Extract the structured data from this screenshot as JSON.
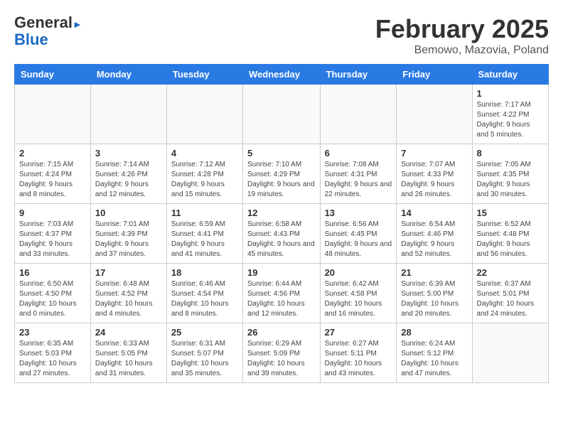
{
  "header": {
    "logo_line1": "General",
    "logo_line2": "Blue",
    "month_title": "February 2025",
    "location": "Bemowo, Mazovia, Poland"
  },
  "days_of_week": [
    "Sunday",
    "Monday",
    "Tuesday",
    "Wednesday",
    "Thursday",
    "Friday",
    "Saturday"
  ],
  "weeks": [
    [
      {
        "day": "",
        "info": ""
      },
      {
        "day": "",
        "info": ""
      },
      {
        "day": "",
        "info": ""
      },
      {
        "day": "",
        "info": ""
      },
      {
        "day": "",
        "info": ""
      },
      {
        "day": "",
        "info": ""
      },
      {
        "day": "1",
        "info": "Sunrise: 7:17 AM\nSunset: 4:22 PM\nDaylight: 9 hours and 5 minutes."
      }
    ],
    [
      {
        "day": "2",
        "info": "Sunrise: 7:15 AM\nSunset: 4:24 PM\nDaylight: 9 hours and 8 minutes."
      },
      {
        "day": "3",
        "info": "Sunrise: 7:14 AM\nSunset: 4:26 PM\nDaylight: 9 hours and 12 minutes."
      },
      {
        "day": "4",
        "info": "Sunrise: 7:12 AM\nSunset: 4:28 PM\nDaylight: 9 hours and 15 minutes."
      },
      {
        "day": "5",
        "info": "Sunrise: 7:10 AM\nSunset: 4:29 PM\nDaylight: 9 hours and 19 minutes."
      },
      {
        "day": "6",
        "info": "Sunrise: 7:08 AM\nSunset: 4:31 PM\nDaylight: 9 hours and 22 minutes."
      },
      {
        "day": "7",
        "info": "Sunrise: 7:07 AM\nSunset: 4:33 PM\nDaylight: 9 hours and 26 minutes."
      },
      {
        "day": "8",
        "info": "Sunrise: 7:05 AM\nSunset: 4:35 PM\nDaylight: 9 hours and 30 minutes."
      }
    ],
    [
      {
        "day": "9",
        "info": "Sunrise: 7:03 AM\nSunset: 4:37 PM\nDaylight: 9 hours and 33 minutes."
      },
      {
        "day": "10",
        "info": "Sunrise: 7:01 AM\nSunset: 4:39 PM\nDaylight: 9 hours and 37 minutes."
      },
      {
        "day": "11",
        "info": "Sunrise: 6:59 AM\nSunset: 4:41 PM\nDaylight: 9 hours and 41 minutes."
      },
      {
        "day": "12",
        "info": "Sunrise: 6:58 AM\nSunset: 4:43 PM\nDaylight: 9 hours and 45 minutes."
      },
      {
        "day": "13",
        "info": "Sunrise: 6:56 AM\nSunset: 4:45 PM\nDaylight: 9 hours and 48 minutes."
      },
      {
        "day": "14",
        "info": "Sunrise: 6:54 AM\nSunset: 4:46 PM\nDaylight: 9 hours and 52 minutes."
      },
      {
        "day": "15",
        "info": "Sunrise: 6:52 AM\nSunset: 4:48 PM\nDaylight: 9 hours and 56 minutes."
      }
    ],
    [
      {
        "day": "16",
        "info": "Sunrise: 6:50 AM\nSunset: 4:50 PM\nDaylight: 10 hours and 0 minutes."
      },
      {
        "day": "17",
        "info": "Sunrise: 6:48 AM\nSunset: 4:52 PM\nDaylight: 10 hours and 4 minutes."
      },
      {
        "day": "18",
        "info": "Sunrise: 6:46 AM\nSunset: 4:54 PM\nDaylight: 10 hours and 8 minutes."
      },
      {
        "day": "19",
        "info": "Sunrise: 6:44 AM\nSunset: 4:56 PM\nDaylight: 10 hours and 12 minutes."
      },
      {
        "day": "20",
        "info": "Sunrise: 6:42 AM\nSunset: 4:58 PM\nDaylight: 10 hours and 16 minutes."
      },
      {
        "day": "21",
        "info": "Sunrise: 6:39 AM\nSunset: 5:00 PM\nDaylight: 10 hours and 20 minutes."
      },
      {
        "day": "22",
        "info": "Sunrise: 6:37 AM\nSunset: 5:01 PM\nDaylight: 10 hours and 24 minutes."
      }
    ],
    [
      {
        "day": "23",
        "info": "Sunrise: 6:35 AM\nSunset: 5:03 PM\nDaylight: 10 hours and 27 minutes."
      },
      {
        "day": "24",
        "info": "Sunrise: 6:33 AM\nSunset: 5:05 PM\nDaylight: 10 hours and 31 minutes."
      },
      {
        "day": "25",
        "info": "Sunrise: 6:31 AM\nSunset: 5:07 PM\nDaylight: 10 hours and 35 minutes."
      },
      {
        "day": "26",
        "info": "Sunrise: 6:29 AM\nSunset: 5:09 PM\nDaylight: 10 hours and 39 minutes."
      },
      {
        "day": "27",
        "info": "Sunrise: 6:27 AM\nSunset: 5:11 PM\nDaylight: 10 hours and 43 minutes."
      },
      {
        "day": "28",
        "info": "Sunrise: 6:24 AM\nSunset: 5:12 PM\nDaylight: 10 hours and 47 minutes."
      },
      {
        "day": "",
        "info": ""
      }
    ]
  ]
}
